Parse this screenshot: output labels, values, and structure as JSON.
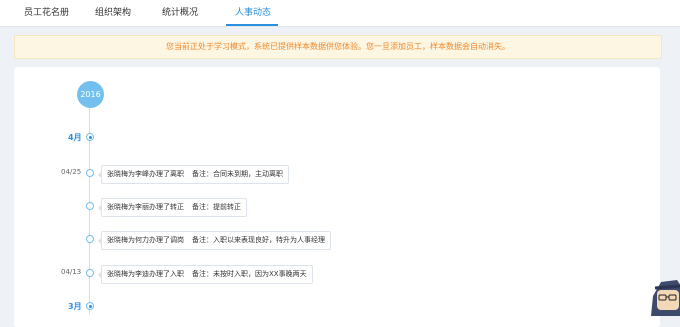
{
  "tabs": [
    {
      "label": "员工花名册"
    },
    {
      "label": "组织架构"
    },
    {
      "label": "统计概况"
    },
    {
      "label": "人事动态",
      "active": true
    }
  ],
  "notice": "您当前正处于学习模式，系统已提供样本数据供您体验。您一旦添加员工，样本数据会自动消失。",
  "timeline": {
    "year": "2016",
    "months": [
      "4月",
      "3月"
    ],
    "events": [
      {
        "date": "04/25",
        "text": "张晓梅为李峰办理了离职",
        "remark": "备注：合同未到期，主动离职"
      },
      {
        "date": "",
        "text": "张晓梅为李丽办理了转正",
        "remark": "备注：提前转正"
      },
      {
        "date": "",
        "text": "张晓梅为何力办理了调岗",
        "remark": "备注：入职以来表现良好，特升为人事经理"
      },
      {
        "date": "04/13",
        "text": "张晓梅为李迪办理了入职",
        "remark": "备注：未按时入职，因为XX事晚两天"
      }
    ]
  },
  "colors": {
    "accent": "#2a8fdd",
    "notice_text": "#f0892a",
    "notice_bg": "#fdf6e3",
    "year_badge": "#73c0ee"
  },
  "icons": {
    "mascot": "mascot-avatar-icon"
  }
}
